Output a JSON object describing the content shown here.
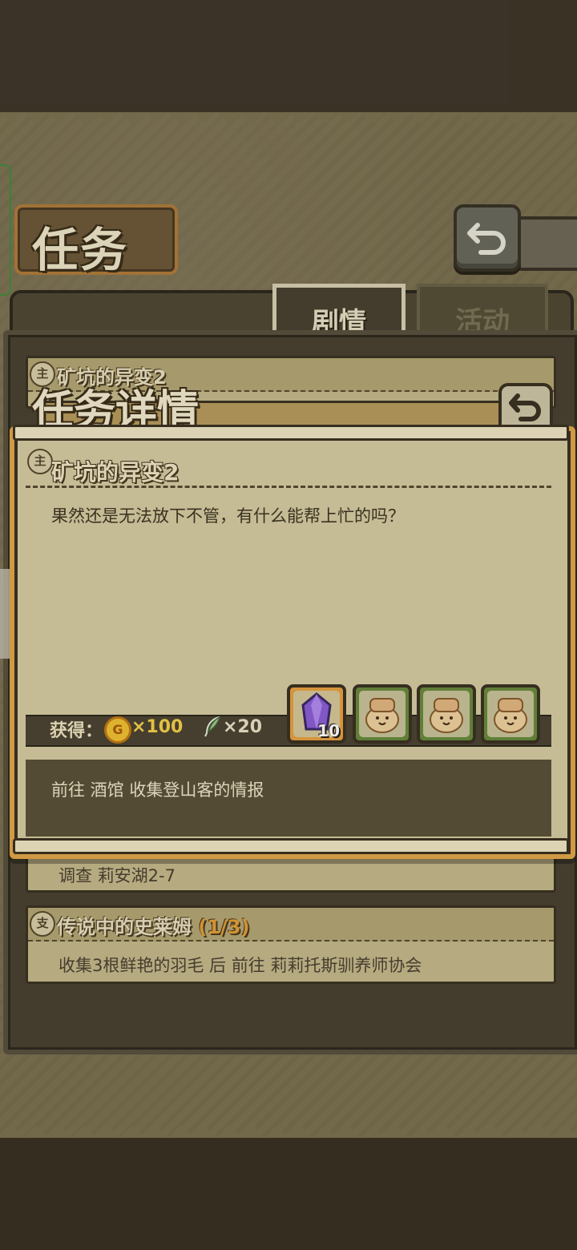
{
  "screen": {
    "title": "任务",
    "tabs": [
      {
        "label": "剧情",
        "active": true
      },
      {
        "label": "活动",
        "active": false
      }
    ]
  },
  "quest_list": [
    {
      "badge": "主",
      "title": "矿坑的异变2",
      "progress": "",
      "desc": ""
    },
    {
      "badge": "",
      "title": "",
      "progress": "",
      "desc": "调查 莉安湖2-7"
    },
    {
      "badge": "支",
      "title": "传说中的史莱姆",
      "progress": "(1/3)",
      "desc": "收集3根鲜艳的羽毛 后 前往 莉莉托斯驯养师协会"
    }
  ],
  "detail": {
    "header": "任务详情",
    "badge": "主",
    "quest_title": "矿坑的异变2",
    "quest_text": "果然还是无法放下不管，有什么能帮上忙的吗？",
    "reward_label": "获得：",
    "coin_symbol": "G",
    "coin_amount": "×100",
    "feather_amount": "×20",
    "items": [
      {
        "icon": "purple-crystal-icon",
        "count": "10"
      },
      {
        "icon": "pet-creature-icon",
        "count": ""
      },
      {
        "icon": "pet-creature-icon",
        "count": ""
      },
      {
        "icon": "pet-creature-icon",
        "count": ""
      }
    ],
    "objective": "前往 酒馆 收集登山客的情报"
  },
  "colors": {
    "accent_orange": "#e2a749",
    "coin_gold": "#f1c232",
    "panel_dark": "#4a4331"
  }
}
